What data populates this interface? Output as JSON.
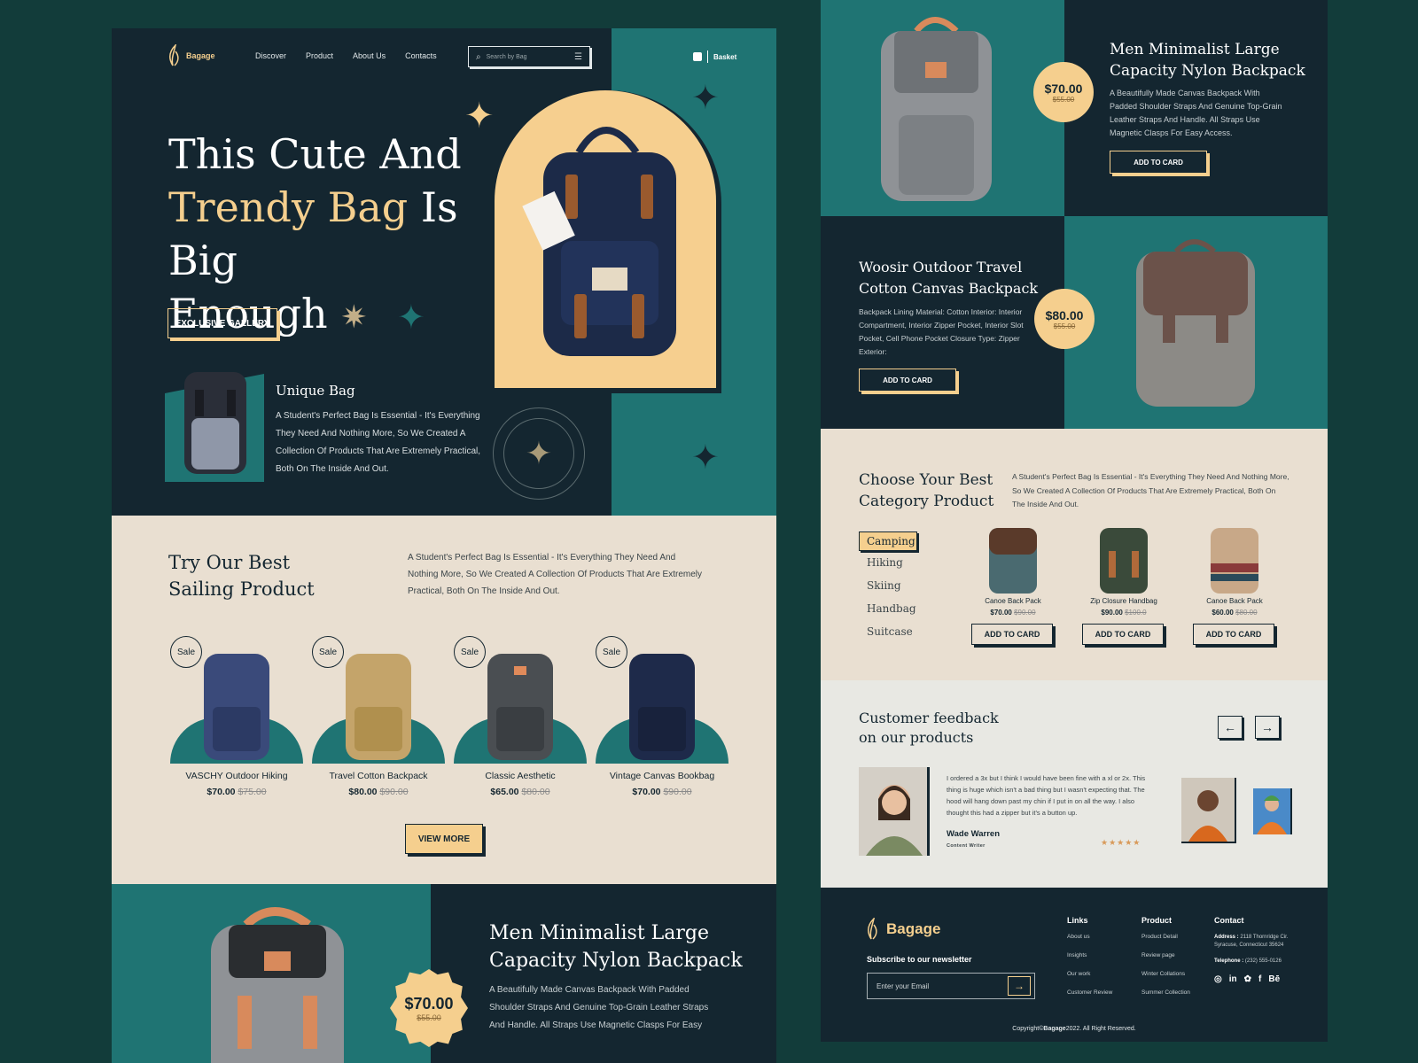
{
  "brand": "Bagage",
  "nav": {
    "items": [
      "Discover",
      "Product",
      "About Us",
      "Contacts"
    ],
    "search_placeholder": "Search by Bag",
    "basket": "Basket"
  },
  "hero": {
    "line1": "This Cute And",
    "line2_gold": "Trendy Bag",
    "line2_rest": " Is Big",
    "line3": "Enough",
    "cta": "EXCLUSIVE GALLERY"
  },
  "unique": {
    "title": "Unique Bag",
    "text": "A Student's Perfect Bag Is Essential - It's Everything They Need And Nothing More, So We Created A Collection Of Products That Are Extremely Practical, Both On The Inside And Out."
  },
  "selling": {
    "title1": "Try Our Best",
    "title2": "Sailing Product",
    "text": "A Student's Perfect Bag Is Essential - It's Everything They Need And Nothing More, So We Created A Collection Of Products That Are Extremely Practical, Both On The Inside And Out.",
    "sale_label": "Sale",
    "view_more": "VIEW MORE",
    "products": [
      {
        "name": "VASCHY Outdoor Hiking",
        "price": "$70.00",
        "old": "$75.00",
        "color": "#3a4a7a"
      },
      {
        "name": "Travel Cotton Backpack",
        "price": "$80.00",
        "old": "$90.00",
        "color": "#c4a46a"
      },
      {
        "name": "Classic Aesthetic",
        "price": "$65.00",
        "old": "$80.00",
        "color": "#4a4e52"
      },
      {
        "name": "Vintage Canvas Bookbag",
        "price": "$70.00",
        "old": "$90.00",
        "color": "#1e2a4a"
      }
    ]
  },
  "feature_bottom": {
    "title1": "Men Minimalist Large",
    "title2": "Capacity Nylon Backpack",
    "price": "$70.00",
    "old": "$55.00",
    "text": "A Beautifully Made Canvas Backpack With Padded Shoulder Straps And Genuine Top-Grain Leather Straps And Handle. All Straps Use Magnetic Clasps For Easy Access."
  },
  "feature_top": {
    "title1": "Men Minimalist Large",
    "title2": "Capacity Nylon Backpack",
    "price": "$70.00",
    "old": "$55.00",
    "text": "A Beautifully Made Canvas Backpack With Padded Shoulder Straps And Genuine Top-Grain Leather Straps And Handle. All Straps Use Magnetic Clasps For Easy Access.",
    "cta": "ADD TO CARD"
  },
  "feature_mid": {
    "title1": "Woosir Outdoor Travel",
    "title2": "Cotton Canvas Backpack",
    "price": "$80.00",
    "old": "$55.00",
    "text": "Backpack Lining Material: Cotton Interior: Interior Compartment, Interior Zipper Pocket, Interior Slot Pocket, Cell Phone Pocket Closure Type: Zipper Exterior:",
    "cta": "ADD TO CARD"
  },
  "category": {
    "title1": "Choose Your Best",
    "title2": "Category  Product",
    "text": "A Student's Perfect Bag Is Essential - It's Everything They Need And Nothing More, So We Created A Collection Of Products That Are Extremely Practical, Both On The Inside And Out.",
    "tabs": [
      "Camping",
      "Hiking",
      "Skiing",
      "Handbag",
      "Suitcase"
    ],
    "active": "Camping",
    "cta": "ADD TO CARD",
    "products": [
      {
        "name": "Canoe Back Pack",
        "price": "$70.00",
        "old": "$90.00",
        "color": "#4a6a70"
      },
      {
        "name": "Zip Closure Handbag",
        "price": "$90.00",
        "old": "$100.0",
        "color": "#3a4a3a"
      },
      {
        "name": "Canoe Back Pack",
        "price": "$60.00",
        "old": "$80.00",
        "color": "#8a3a3a"
      }
    ]
  },
  "feedback": {
    "title1": "Customer feedback",
    "title2": "on our products",
    "quote": "I ordered a 3x but I think I would have been fine with a xl or 2x. This thing is huge which isn't a bad thing but I wasn't expecting that. The hood will hang down past my chin if I put in on all the way. I also thought this had a zipper but it's a button up.",
    "name": "Wade Warren",
    "role": "Content Writer",
    "stars": "★★★★★",
    "prev": "←",
    "next": "→"
  },
  "footer": {
    "brand": "Bagage",
    "subscribe": "Subscribe to our newsletter",
    "email_placeholder": "Enter your Email",
    "links_title": "Links",
    "links": [
      "About us",
      "Insights",
      "Our work",
      "Customer Review"
    ],
    "product_title": "Product",
    "product_links": [
      "Product Detail",
      "Review page",
      "Winter Collations",
      "Summer Collection"
    ],
    "contact_title": "Contact",
    "address_label": "Address :",
    "address": "2118 Thornridge Cir. Syracuse, Connecticut 35624",
    "phone_label": "Telephone :",
    "phone": "(232) 555-0126",
    "social": [
      "◎",
      "in",
      "✿",
      "f",
      "Bē"
    ],
    "copyright_pre": "Copyright©",
    "copyright_brand": "Bagage",
    "copyright_post": "2022. All Right Reserved."
  },
  "colors": {
    "navy": "#142630",
    "teal": "#1f7473",
    "cream": "#e9dfd1",
    "gold": "#f5cf8e",
    "bg": "#123c3a"
  }
}
